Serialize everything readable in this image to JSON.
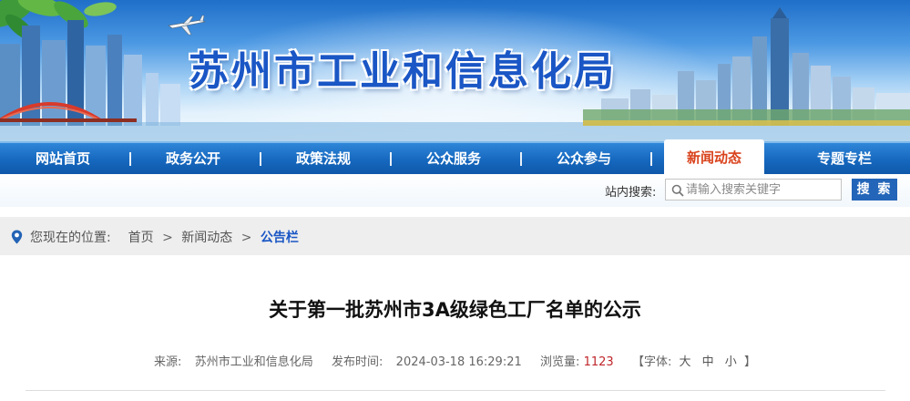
{
  "site": {
    "title": "苏州市工业和信息化局"
  },
  "nav": {
    "items": [
      {
        "label": "网站首页"
      },
      {
        "label": "政务公开"
      },
      {
        "label": "政策法规"
      },
      {
        "label": "公众服务"
      },
      {
        "label": "公众参与"
      },
      {
        "label": "新闻动态"
      },
      {
        "label": "专题专栏"
      }
    ],
    "active_index": 5
  },
  "search": {
    "label": "站内搜索:",
    "placeholder": "请输入搜索关键字",
    "button_label": "搜 索"
  },
  "breadcrumb": {
    "prefix": "您现在的位置:",
    "items": [
      "首页",
      "新闻动态",
      "公告栏"
    ],
    "separator": ">"
  },
  "article": {
    "title": "关于第一批苏州市3A级绿色工厂名单的公示",
    "source_label": "来源:",
    "source_value": "苏州市工业和信息化局",
    "publish_label": "发布时间:",
    "publish_value": "2024-03-18 16:29:21",
    "views_label": "浏览量:",
    "views_value": "1123",
    "font_open": "【字体:",
    "font_large": "大",
    "font_medium": "中",
    "font_small": "小",
    "font_close": "】"
  },
  "colors": {
    "brand_blue": "#1a56c5",
    "nav_blue": "#1668bf",
    "active_tab_text": "#d9421c",
    "views_red": "#c0262b"
  }
}
